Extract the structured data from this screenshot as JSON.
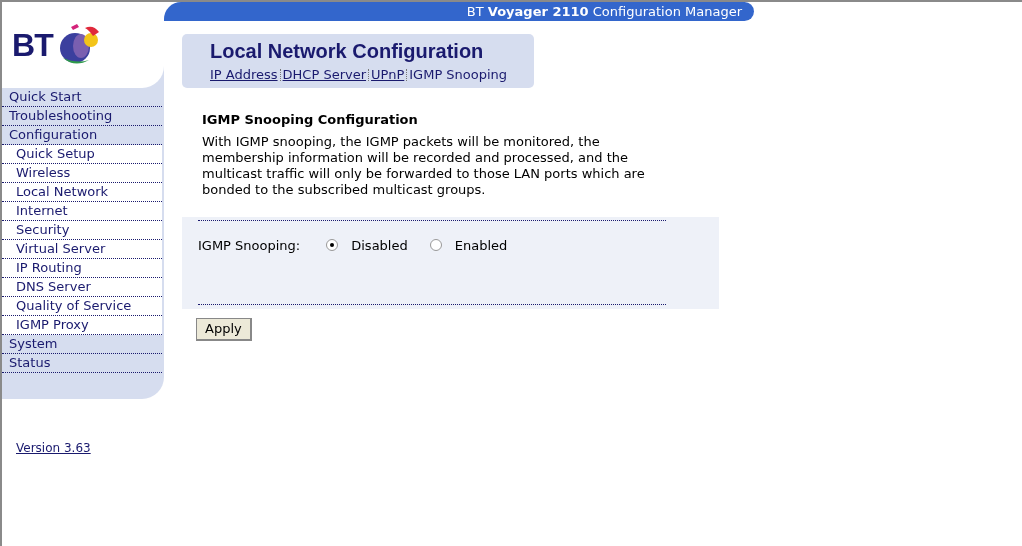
{
  "logo": {
    "text": "BT"
  },
  "header": {
    "title": "BT **Voyager 2110** Configuration Manager"
  },
  "sidebar": {
    "items": [
      {
        "label": "Quick Start"
      },
      {
        "label": "Troubleshooting"
      },
      {
        "label": "Configuration",
        "children": [
          {
            "label": "Quick Setup"
          },
          {
            "label": "Wireless"
          },
          {
            "label": "Local Network"
          },
          {
            "label": "Internet"
          },
          {
            "label": "Security"
          },
          {
            "label": "Virtual Server"
          },
          {
            "label": "IP Routing"
          },
          {
            "label": "DNS Server"
          },
          {
            "label": "Quality of Service"
          },
          {
            "label": "IGMP Proxy"
          }
        ]
      },
      {
        "label": "System"
      },
      {
        "label": "Status"
      }
    ],
    "version": "Version 3.63"
  },
  "page": {
    "title": "Local Network Configuration",
    "tabs": [
      {
        "label": "IP Address",
        "selected": false
      },
      {
        "label": "DHCP Server",
        "selected": false
      },
      {
        "label": "UPnP",
        "selected": false
      },
      {
        "label": "IGMP Snooping",
        "selected": true
      }
    ]
  },
  "section": {
    "title": "IGMP Snooping Configuration",
    "description": "With IGMP snooping, the IGMP packets will be monitored, the membership information will be recorded and processed, and the multicast traffic will only be forwarded to those LAN ports which are bonded to the subscribed multicast groups."
  },
  "form": {
    "label": "IGMP Snooping:",
    "options": [
      {
        "label": "Disabled",
        "selected": true
      },
      {
        "label": "Enabled",
        "selected": false
      }
    ]
  },
  "buttons": [
    {
      "label": "Apply"
    }
  ]
}
